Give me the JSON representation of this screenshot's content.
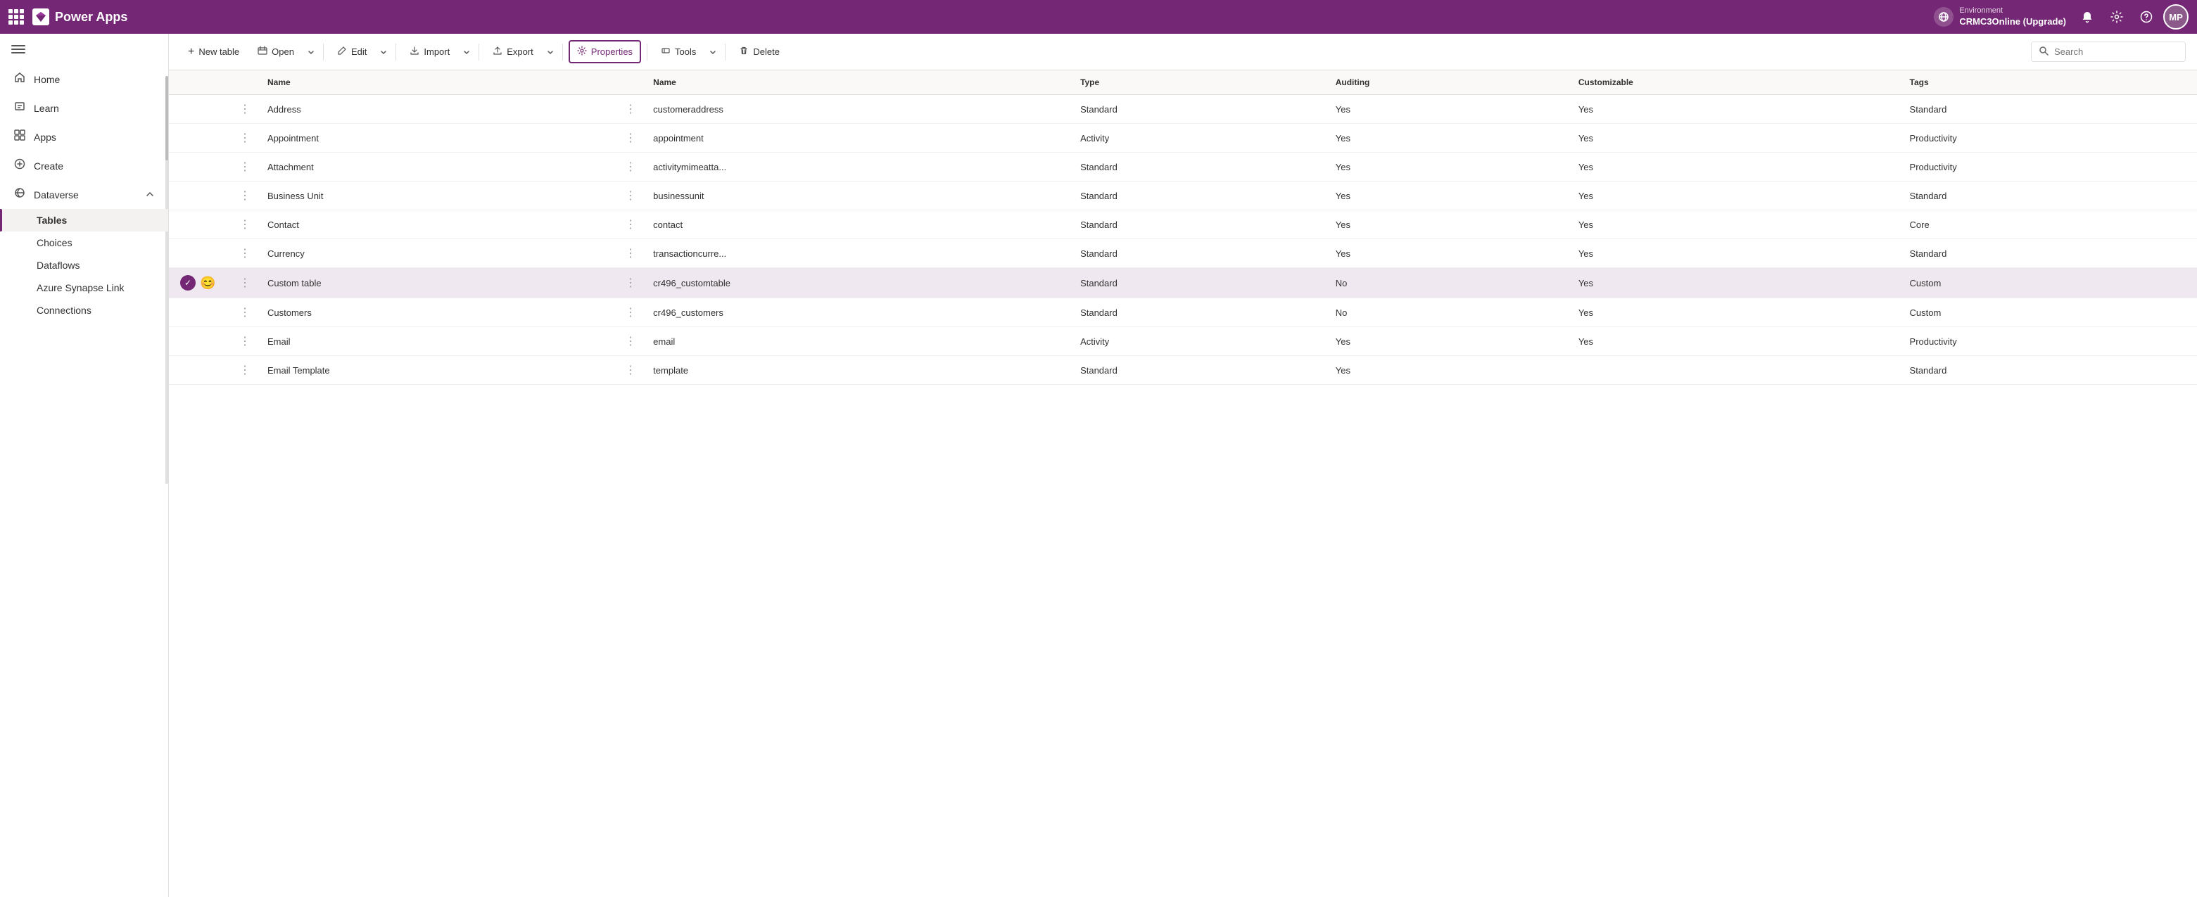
{
  "topbar": {
    "grid_icon": "apps-icon",
    "app_name": "Power Apps",
    "environment_label": "Environment",
    "environment_name": "CRMC3Online (Upgrade)",
    "notification_icon": "bell-icon",
    "settings_icon": "gear-icon",
    "help_icon": "help-icon",
    "avatar_initials": "MP"
  },
  "sidebar": {
    "toggle_icon": "hamburger-icon",
    "items": [
      {
        "id": "home",
        "label": "Home",
        "icon": "home-icon"
      },
      {
        "id": "learn",
        "label": "Learn",
        "icon": "book-icon"
      },
      {
        "id": "apps",
        "label": "Apps",
        "icon": "apps-grid-icon"
      },
      {
        "id": "create",
        "label": "Create",
        "icon": "plus-icon"
      }
    ],
    "dataverse_section": {
      "label": "Dataverse",
      "icon": "dataverse-icon",
      "expanded": true,
      "sub_items": [
        {
          "id": "tables",
          "label": "Tables",
          "active": true
        },
        {
          "id": "choices",
          "label": "Choices",
          "active": false
        },
        {
          "id": "dataflows",
          "label": "Dataflows",
          "active": false
        },
        {
          "id": "azure-synapse",
          "label": "Azure Synapse Link",
          "active": false
        },
        {
          "id": "connections",
          "label": "Connections",
          "active": false
        }
      ]
    }
  },
  "toolbar": {
    "new_table_label": "New table",
    "open_label": "Open",
    "edit_label": "Edit",
    "import_label": "Import",
    "export_label": "Export",
    "properties_label": "Properties",
    "tools_label": "Tools",
    "delete_label": "Delete",
    "search_placeholder": "Search"
  },
  "table": {
    "columns": [
      {
        "id": "icons",
        "label": ""
      },
      {
        "id": "menu",
        "label": ""
      },
      {
        "id": "name",
        "label": "Name"
      },
      {
        "id": "col_menu",
        "label": ""
      },
      {
        "id": "name_logical",
        "label": "Name"
      },
      {
        "id": "type",
        "label": "Type"
      },
      {
        "id": "auditing",
        "label": "Auditing"
      },
      {
        "id": "customizable",
        "label": "Customizable"
      },
      {
        "id": "tags",
        "label": "Tags"
      }
    ],
    "rows": [
      {
        "id": "address",
        "icons": "",
        "name": "Address",
        "name_logical": "customeraddress",
        "type": "Standard",
        "auditing": "Yes",
        "customizable": "Yes",
        "tags": "Standard",
        "selected": false
      },
      {
        "id": "appointment",
        "icons": "",
        "name": "Appointment",
        "name_logical": "appointment",
        "type": "Activity",
        "auditing": "Yes",
        "customizable": "Yes",
        "tags": "Productivity",
        "selected": false
      },
      {
        "id": "attachment",
        "icons": "",
        "name": "Attachment",
        "name_logical": "activitymimeatta...",
        "type": "Standard",
        "auditing": "Yes",
        "customizable": "Yes",
        "tags": "Productivity",
        "selected": false
      },
      {
        "id": "business-unit",
        "icons": "",
        "name": "Business Unit",
        "name_logical": "businessunit",
        "type": "Standard",
        "auditing": "Yes",
        "customizable": "Yes",
        "tags": "Standard",
        "selected": false
      },
      {
        "id": "contact",
        "icons": "",
        "name": "Contact",
        "name_logical": "contact",
        "type": "Standard",
        "auditing": "Yes",
        "customizable": "Yes",
        "tags": "Core",
        "selected": false
      },
      {
        "id": "currency",
        "icons": "",
        "name": "Currency",
        "name_logical": "transactioncurre...",
        "type": "Standard",
        "auditing": "Yes",
        "customizable": "Yes",
        "tags": "Standard",
        "selected": false
      },
      {
        "id": "custom-table",
        "icons": "check+emoji",
        "name": "Custom table",
        "name_logical": "cr496_customtable",
        "type": "Standard",
        "auditing": "No",
        "customizable": "Yes",
        "tags": "Custom",
        "selected": true
      },
      {
        "id": "customers",
        "icons": "",
        "name": "Customers",
        "name_logical": "cr496_customers",
        "type": "Standard",
        "auditing": "No",
        "customizable": "Yes",
        "tags": "Custom",
        "selected": false
      },
      {
        "id": "email",
        "icons": "",
        "name": "Email",
        "name_logical": "email",
        "type": "Activity",
        "auditing": "Yes",
        "customizable": "Yes",
        "tags": "Productivity",
        "selected": false
      },
      {
        "id": "email-template",
        "icons": "",
        "name": "Email Template",
        "name_logical": "template",
        "type": "Standard",
        "auditing": "Yes",
        "customizable": "",
        "tags": "Standard",
        "selected": false,
        "partial": true
      }
    ]
  }
}
